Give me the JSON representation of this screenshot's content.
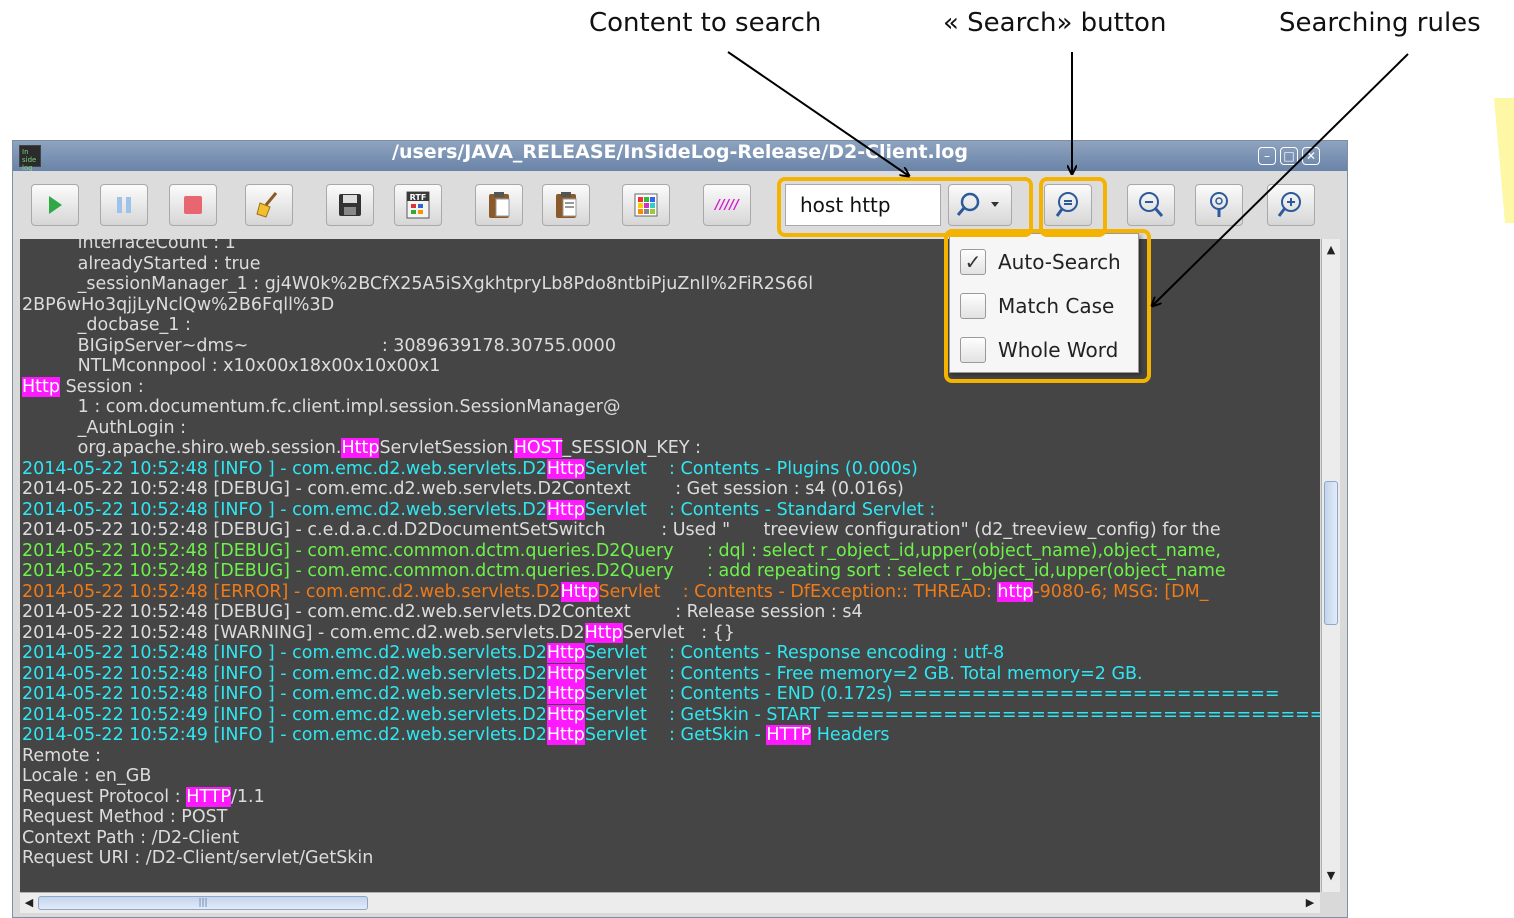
{
  "callouts": {
    "content": "Content to search",
    "button": "« Search» button",
    "rules": "Searching rules"
  },
  "window": {
    "title": "/users/JAVA_RELEASE/InSideLog-Release/D2-Client.log",
    "app_icon_text": "In side\nlog"
  },
  "toolbar": {
    "play_icon": "play-icon",
    "pause_icon": "pause-icon",
    "stop_icon": "stop-icon",
    "clear_icon": "broom-icon",
    "save_icon": "floppy-disk-icon",
    "rtf_label": "RTF",
    "paste_icon": "clipboard-icon",
    "paste2_icon": "clipboard-icon",
    "palette_icon": "color-grid-icon",
    "stripes_label": "/////",
    "search_value": "host http",
    "search_icon": "search-icon",
    "find_icon": "find-icon",
    "zoom_out_icon": "zoom-out-icon",
    "zoom_reset_icon": "zoom-reset-icon",
    "zoom_in_icon": "zoom-in-icon"
  },
  "search_menu": [
    {
      "label": "Auto-Search",
      "checked": true
    },
    {
      "label": "Match Case",
      "checked": false
    },
    {
      "label": "Whole Word",
      "checked": false
    }
  ],
  "colors": {
    "highlight_box": "#f5b301",
    "match_highlight": "#ff19ff",
    "log_background": "#454545",
    "info": "#2ee7f2",
    "debug_query": "#6ef14a",
    "error": "#ee7a18",
    "normal": "#dcdcdc"
  },
  "log_lines": [
    {
      "cls": "c-white",
      "segs": [
        [
          "          interfaceCount : 1",
          false
        ]
      ]
    },
    {
      "cls": "c-white",
      "segs": [
        [
          "          alreadyStarted : true",
          false
        ]
      ]
    },
    {
      "cls": "c-white",
      "segs": [
        [
          "          _sessionManager_1 : gj4W0k%2BCfX25A5iSXgkhtpryLb8Pdo8ntbiPjuZnll%2FiR2S66l",
          false
        ]
      ]
    },
    {
      "cls": "c-white",
      "segs": [
        [
          "2BP6wHo3qjjLyNclQw%2B6Fqll%3D",
          false
        ]
      ]
    },
    {
      "cls": "c-white",
      "segs": [
        [
          "          _docbase_1 :",
          false
        ]
      ]
    },
    {
      "cls": "c-white",
      "segs": [
        [
          "          BIGipServer~dms~                        : 3089639178.30755.0000",
          false
        ]
      ]
    },
    {
      "cls": "c-white",
      "segs": [
        [
          "          NTLMconnpool : x10x00x18x00x10x00x1",
          false
        ]
      ]
    },
    {
      "cls": "c-white",
      "segs": [
        [
          "Http",
          true
        ],
        [
          " Session :",
          false
        ]
      ]
    },
    {
      "cls": "c-white",
      "segs": [
        [
          "          1 : com.documentum.fc.client.impl.session.SessionManager@",
          false
        ]
      ]
    },
    {
      "cls": "c-white",
      "segs": [
        [
          "          _AuthLogin :",
          false
        ]
      ]
    },
    {
      "cls": "c-white",
      "segs": [
        [
          "          org.apache.shiro.web.session.",
          false
        ],
        [
          "Http",
          true
        ],
        [
          "ServletSession.",
          false
        ],
        [
          "HOST",
          true
        ],
        [
          "_SESSION_KEY :",
          false
        ]
      ]
    },
    {
      "cls": "c-cyan",
      "segs": [
        [
          "2014-05-22 10:52:48 [INFO ] - com.emc.d2.web.servlets.D2",
          false
        ],
        [
          "Http",
          true
        ],
        [
          "Servlet    : Contents - Plugins (0.000s)",
          false
        ]
      ]
    },
    {
      "cls": "c-white",
      "segs": [
        [
          "2014-05-22 10:52:48 [DEBUG] - com.emc.d2.web.servlets.D2Context        : Get session : s4 (0.016s)",
          false
        ]
      ]
    },
    {
      "cls": "c-cyan",
      "segs": [
        [
          "2014-05-22 10:52:48 [INFO ] - com.emc.d2.web.servlets.D2",
          false
        ],
        [
          "Http",
          true
        ],
        [
          "Servlet    : Contents - Standard Servlet :",
          false
        ]
      ]
    },
    {
      "cls": "c-white",
      "segs": [
        [
          "2014-05-22 10:52:48 [DEBUG] - c.e.d.a.c.d.D2DocumentSetSwitch          : Used \"      treeview configuration\" (d2_treeview_config) for the",
          false
        ]
      ]
    },
    {
      "cls": "c-green",
      "segs": [
        [
          "2014-05-22 10:52:48 [DEBUG] - com.emc.common.dctm.queries.D2Query      : dql : select r_object_id,upper(object_name),object_name,",
          false
        ]
      ]
    },
    {
      "cls": "c-green",
      "segs": [
        [
          "2014-05-22 10:52:48 [DEBUG] - com.emc.common.dctm.queries.D2Query      : add repeating sort : select r_object_id,upper(object_name",
          false
        ]
      ]
    },
    {
      "cls": "c-orange",
      "segs": [
        [
          "2014-05-22 10:52:48 [ERROR] - com.emc.d2.web.servlets.D2",
          false
        ],
        [
          "Http",
          true
        ],
        [
          "Servlet    : Contents - DfException:: THREAD: ",
          false
        ],
        [
          "http",
          true
        ],
        [
          "-9080-6; MSG: [DM_",
          false
        ]
      ]
    },
    {
      "cls": "c-white",
      "segs": [
        [
          "2014-05-22 10:52:48 [DEBUG] - com.emc.d2.web.servlets.D2Context        : Release session : s4",
          false
        ]
      ]
    },
    {
      "cls": "c-white",
      "segs": [
        [
          "2014-05-22 10:52:48 [WARNING] - com.emc.d2.web.servlets.D2",
          false
        ],
        [
          "Http",
          true
        ],
        [
          "Servlet   : {}",
          false
        ]
      ]
    },
    {
      "cls": "c-cyan",
      "segs": [
        [
          "2014-05-22 10:52:48 [INFO ] - com.emc.d2.web.servlets.D2",
          false
        ],
        [
          "Http",
          true
        ],
        [
          "Servlet    : Contents - Response encoding : utf-8",
          false
        ]
      ]
    },
    {
      "cls": "c-cyan",
      "segs": [
        [
          "2014-05-22 10:52:48 [INFO ] - com.emc.d2.web.servlets.D2",
          false
        ],
        [
          "Http",
          true
        ],
        [
          "Servlet    : Contents - Free memory=2 GB. Total memory=2 GB.",
          false
        ]
      ]
    },
    {
      "cls": "c-cyan",
      "segs": [
        [
          "2014-05-22 10:52:48 [INFO ] - com.emc.d2.web.servlets.D2",
          false
        ],
        [
          "Http",
          true
        ],
        [
          "Servlet    : Contents - END (0.172s) ==========================",
          false
        ]
      ]
    },
    {
      "cls": "c-cyan",
      "segs": [
        [
          "2014-05-22 10:52:49 [INFO ] - com.emc.d2.web.servlets.D2",
          false
        ],
        [
          "Http",
          true
        ],
        [
          "Servlet    : GetSkin - START ==================================",
          false
        ]
      ]
    },
    {
      "cls": "c-cyan",
      "segs": [
        [
          "2014-05-22 10:52:49 [INFO ] - com.emc.d2.web.servlets.D2",
          false
        ],
        [
          "Http",
          true
        ],
        [
          "Servlet    : GetSkin - ",
          false
        ],
        [
          "HTTP",
          true
        ],
        [
          " Headers",
          false
        ]
      ]
    },
    {
      "cls": "c-white",
      "segs": [
        [
          "Remote :",
          false
        ]
      ]
    },
    {
      "cls": "c-white",
      "segs": [
        [
          "Locale : en_GB",
          false
        ]
      ]
    },
    {
      "cls": "c-white",
      "segs": [
        [
          "Request Protocol : ",
          false
        ],
        [
          "HTTP",
          true
        ],
        [
          "/1.1",
          false
        ]
      ]
    },
    {
      "cls": "c-white",
      "segs": [
        [
          "Request Method : POST",
          false
        ]
      ]
    },
    {
      "cls": "c-white",
      "segs": [
        [
          "Context Path : /D2-Client",
          false
        ]
      ]
    },
    {
      "cls": "c-white",
      "segs": [
        [
          "Request URI : /D2-Client/servlet/GetSkin",
          false
        ]
      ]
    }
  ]
}
